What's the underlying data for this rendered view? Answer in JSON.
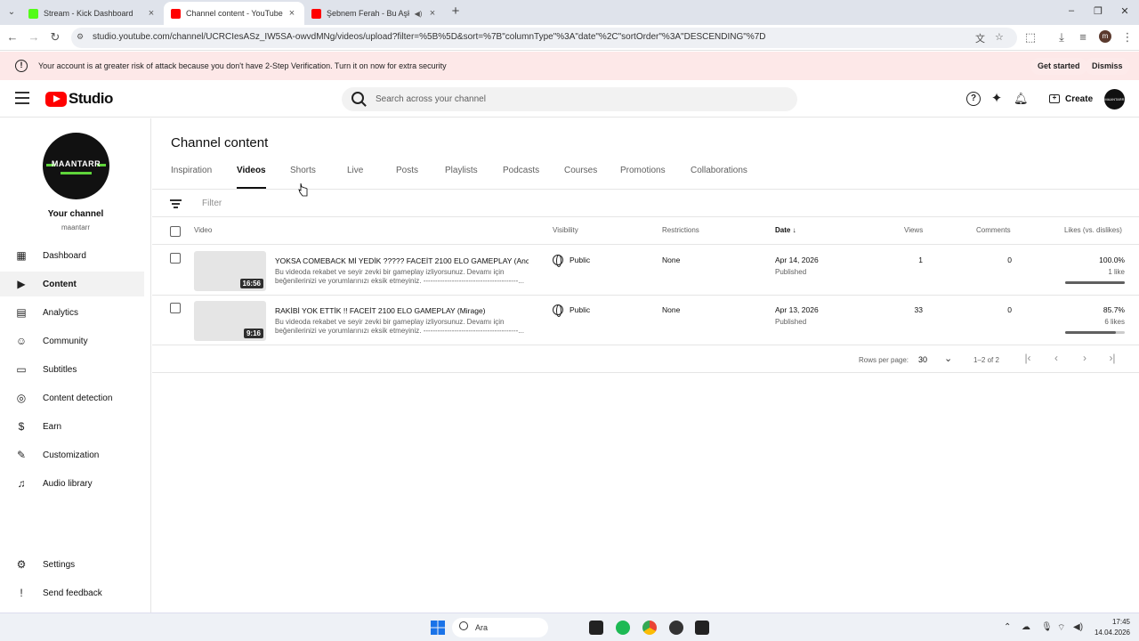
{
  "browser": {
    "tabs": [
      {
        "label": "Stream - Kick Dashboard",
        "color": "#53fc18"
      },
      {
        "label": "Channel content - YouTube Stu",
        "color": "#ff0000"
      },
      {
        "label": "Şebnem Ferah - Bu Aşk Fazl",
        "color": "#ff0000"
      }
    ],
    "url": "studio.youtube.com/channel/UCRCIesASz_IW5SA-owvdMNg/videos/upload?filter=%5B%5D&sort=%7B\"columnType\"%3A\"date\"%2C\"sortOrder\"%3A\"DESCENDING\"%7D",
    "profile_initial": "m"
  },
  "warning": {
    "text": "Your account is at greater risk of attack because you don't have 2-Step Verification. Turn it on now for extra security",
    "get_started": "Get started",
    "dismiss": "Dismiss"
  },
  "header": {
    "logo_text": "Studio",
    "search_placeholder": "Search across your channel",
    "create_label": "Create"
  },
  "sidebar": {
    "channel_avatar_text": "MAANTARR",
    "channel_title": "Your channel",
    "channel_handle": "maantarr",
    "items": [
      {
        "label": "Dashboard",
        "icon": "dashboard-icon"
      },
      {
        "label": "Content",
        "icon": "content-icon"
      },
      {
        "label": "Analytics",
        "icon": "analytics-icon"
      },
      {
        "label": "Community",
        "icon": "community-icon"
      },
      {
        "label": "Subtitles",
        "icon": "subtitles-icon"
      },
      {
        "label": "Content detection",
        "icon": "content-detection-icon"
      },
      {
        "label": "Earn",
        "icon": "earn-icon"
      },
      {
        "label": "Customization",
        "icon": "customization-icon"
      },
      {
        "label": "Audio library",
        "icon": "audio-library-icon"
      }
    ],
    "settings": "Settings",
    "feedback": "Send feedback"
  },
  "main": {
    "title": "Channel content",
    "tabs": [
      "Inspiration",
      "Videos",
      "Shorts",
      "Live",
      "Posts",
      "Playlists",
      "Podcasts",
      "Courses",
      "Promotions",
      "Collaborations"
    ],
    "filter_placeholder": "Filter",
    "columns": {
      "video": "Video",
      "visibility": "Visibility",
      "restrictions": "Restrictions",
      "date": "Date",
      "views": "Views",
      "comments": "Comments",
      "likes": "Likes (vs. dislikes)"
    },
    "videos": [
      {
        "title": "YOKSA COMEBACK Mİ YEDİK ????? FACEİT 2100 ELO GAMEPLAY (Ancie...",
        "description": "Bu videoda rekabet ve seyir zevki bir gameplay izliyorsunuz. Devamı için beğenilerinizi ve yorumlarınızı eksik etmeyiniz. ----------------------------------------...",
        "duration": "16:56",
        "visibility": "Public",
        "restrictions": "None",
        "date": "Apr 14, 2026",
        "status": "Published",
        "views": "1",
        "comments": "0",
        "likes_pct": "100.0%",
        "likes_count": "1 like",
        "likes_ratio": 1.0
      },
      {
        "title": "RAKİBİ YOK ETTİK !! FACEİT 2100 ELO GAMEPLAY (Mirage)",
        "description": "Bu videoda rekabet ve seyir zevki bir gameplay izliyorsunuz. Devamı için beğenilerinizi ve yorumlarınızı eksik etmeyiniz. ----------------------------------------...",
        "duration": "9:16",
        "visibility": "Public",
        "restrictions": "None",
        "date": "Apr 13, 2026",
        "status": "Published",
        "views": "33",
        "comments": "0",
        "likes_pct": "85.7%",
        "likes_count": "6 likes",
        "likes_ratio": 0.857
      }
    ],
    "pagination": {
      "rows_label": "Rows per page:",
      "rows_value": "30",
      "range": "1–2 of 2"
    }
  },
  "taskbar": {
    "search_label": "Ara",
    "time": "17:45",
    "date": "14.04.2026"
  }
}
